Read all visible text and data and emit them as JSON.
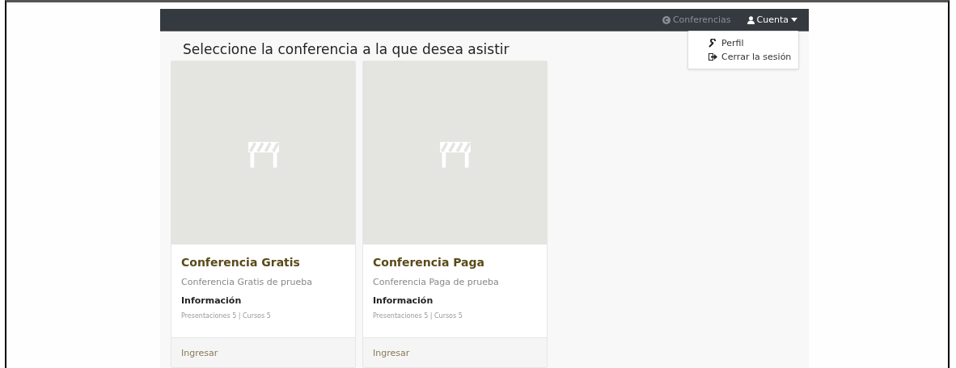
{
  "navbar": {
    "brand": "Conferencias",
    "account": {
      "label": "Cuenta",
      "expanded": true,
      "menu": [
        {
          "kind": "wrench",
          "label": "Perfil"
        },
        {
          "kind": "logout",
          "label": "Cerrar la sesión"
        }
      ]
    }
  },
  "heading": "Seleccione la conferencia a la que desea asistir",
  "cards": [
    {
      "title": "Conferencia Gratis",
      "description": "Conferencia Gratis de prueba",
      "info_title": "Información",
      "info": "Presentaciones 5 | Cursos 5",
      "action": "Ingresar"
    },
    {
      "title": "Conferencia Paga",
      "description": "Conferencia Paga de prueba",
      "info_title": "Información",
      "info": "Presentaciones 5 | Cursos 5",
      "action": "Ingresar"
    }
  ]
}
